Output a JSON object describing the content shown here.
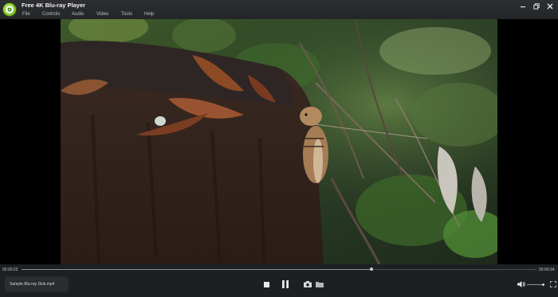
{
  "app": {
    "title": "Free 4K Blu-ray Player"
  },
  "menu": [
    "File",
    "Controls",
    "Audio",
    "Video",
    "Tools",
    "Help"
  ],
  "player": {
    "current_time": "00:00:23",
    "total_time": "00:00:34",
    "progress": 0.68,
    "volume": 0.95,
    "file_name": "Sample Blu-ray Disk.mp4"
  },
  "icons": {
    "logo": "app-logo-icon",
    "minimize": "minimize-icon",
    "restore": "restore-icon",
    "close": "close-icon",
    "stop": "stop-icon",
    "pause": "pause-icon",
    "snapshot": "camera-icon",
    "folder": "folder-icon",
    "volume": "volume-icon",
    "fullscreen": "fullscreen-icon"
  },
  "colors": {
    "accent": "#7cc23a",
    "background": "#1b1c1e"
  }
}
